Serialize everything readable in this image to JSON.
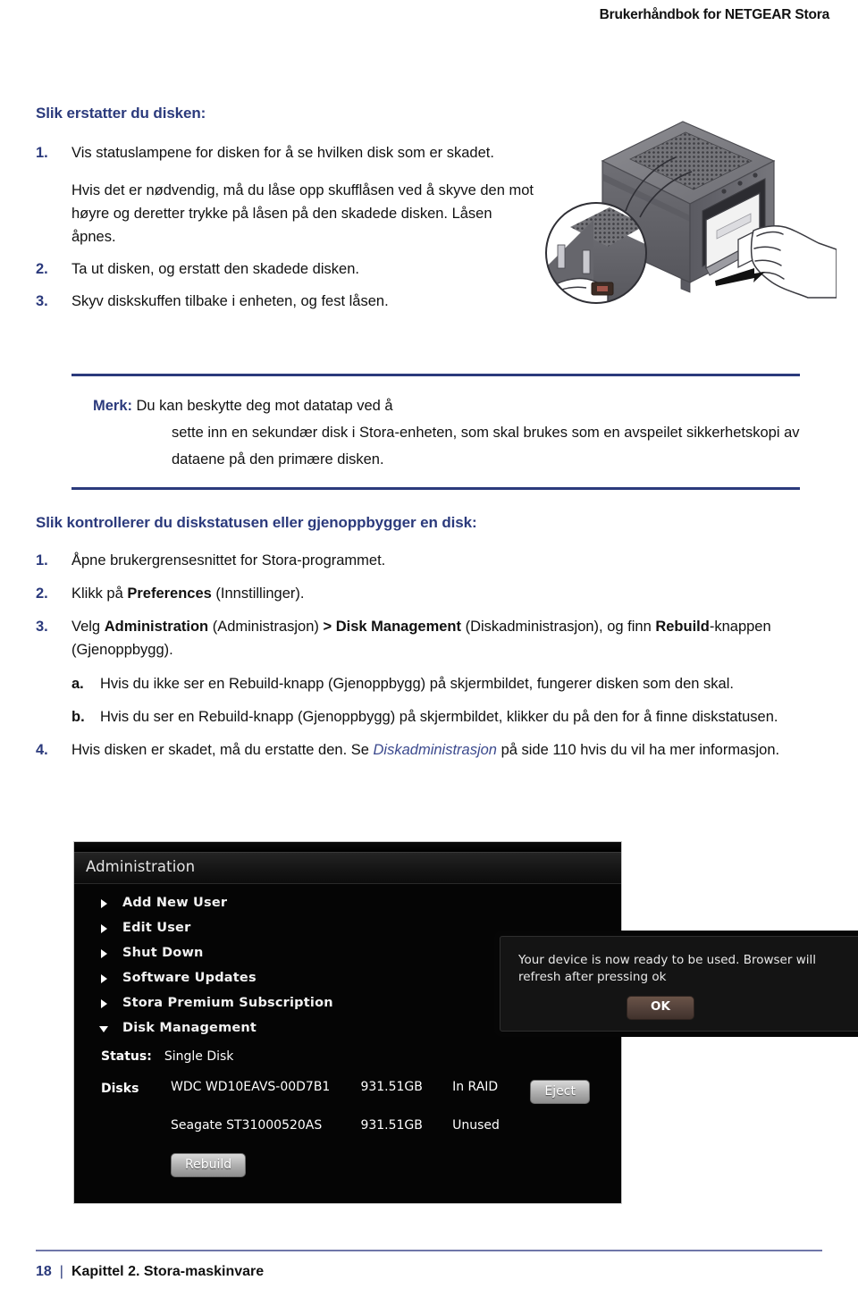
{
  "header": {
    "title": "Brukerhåndbok for NETGEAR Stora"
  },
  "sections": {
    "replace_disk": {
      "heading": "Slik erstatter du disken:",
      "steps": [
        {
          "num": "1.",
          "paragraphs": [
            "Vis statuslampene for disken for å se hvilken disk som er skadet.",
            "Hvis det er nødvendig, må du låse opp skufflåsen ved å skyve den mot høyre og deretter trykke på låsen på den skadede disken. Låsen åpnes."
          ]
        },
        {
          "num": "2.",
          "paragraphs": [
            "Ta ut disken, og erstatt den skadede disken."
          ]
        },
        {
          "num": "3.",
          "paragraphs": [
            "Skyv diskskuffen tilbake i enheten, og fest låsen."
          ]
        }
      ]
    },
    "note": {
      "label": "Merk:",
      "line1": "Du kan beskytte deg mot datatap ved å",
      "line2": "sette inn en sekundær disk i Stora-enheten, som skal brukes som en avspeilet sikkerhetskopi av dataene på den primære disken."
    },
    "check_status": {
      "heading": "Slik kontrollerer du diskstatusen eller gjenoppbygger en disk:",
      "step1": {
        "num": "1.",
        "text": "Åpne brukergrensesnittet for Stora-programmet."
      },
      "step2": {
        "num": "2.",
        "prefix": "Klikk på ",
        "bold": "Preferences",
        "suffix": " (Innstillinger)."
      },
      "step3": {
        "num": "3.",
        "t1": "Velg ",
        "b1": "Administration",
        "t2": " (Administrasjon) ",
        "b2": "> Disk Management",
        "t3": " (Diskadministrasjon), og finn ",
        "b3": "Rebuild",
        "t4": "-knappen (Gjenoppbygg).",
        "substeps": [
          {
            "num": "a.",
            "text": "Hvis du ikke ser en Rebuild-knapp (Gjenoppbygg) på skjermbildet, fungerer disken som den skal."
          },
          {
            "num": "b.",
            "text": "Hvis du ser en Rebuild-knapp (Gjenoppbygg) på skjermbildet, klikker du på den for å finne diskstatusen."
          }
        ]
      },
      "step4": {
        "num": "4.",
        "t1": "Hvis disken er skadet, må du erstatte den. Se ",
        "xref": "Diskadministrasjon",
        "t2": " på side 110 hvis du vil ha mer informasjon."
      }
    }
  },
  "screenshot": {
    "window_title": "Administration",
    "menu_items": [
      {
        "label": "Add New User",
        "state": "collapsed"
      },
      {
        "label": "Edit User",
        "state": "collapsed"
      },
      {
        "label": "Shut Down",
        "state": "collapsed"
      },
      {
        "label": "Software Updates",
        "state": "collapsed"
      },
      {
        "label": "Stora Premium Subscription",
        "state": "collapsed"
      },
      {
        "label": "Disk Management",
        "state": "expanded"
      }
    ],
    "status_label": "Status:",
    "status_value": "Single Disk",
    "disks_label": "Disks",
    "disks": [
      {
        "model": "WDC WD10EAVS-00D7B1",
        "size": "931.51GB",
        "state": "In RAID",
        "action": "Eject"
      },
      {
        "model": "Seagate ST31000520AS",
        "size": "931.51GB",
        "state": "Unused",
        "action": ""
      }
    ],
    "rebuild_button": "Rebuild",
    "dialog": {
      "message": "Your device is now ready to be used.  Browser will refresh after pressing ok",
      "ok_button": "OK"
    }
  },
  "footer": {
    "page_number": "18",
    "separator": "|",
    "chapter": "Kapittel 2. Stora-maskinvare"
  }
}
